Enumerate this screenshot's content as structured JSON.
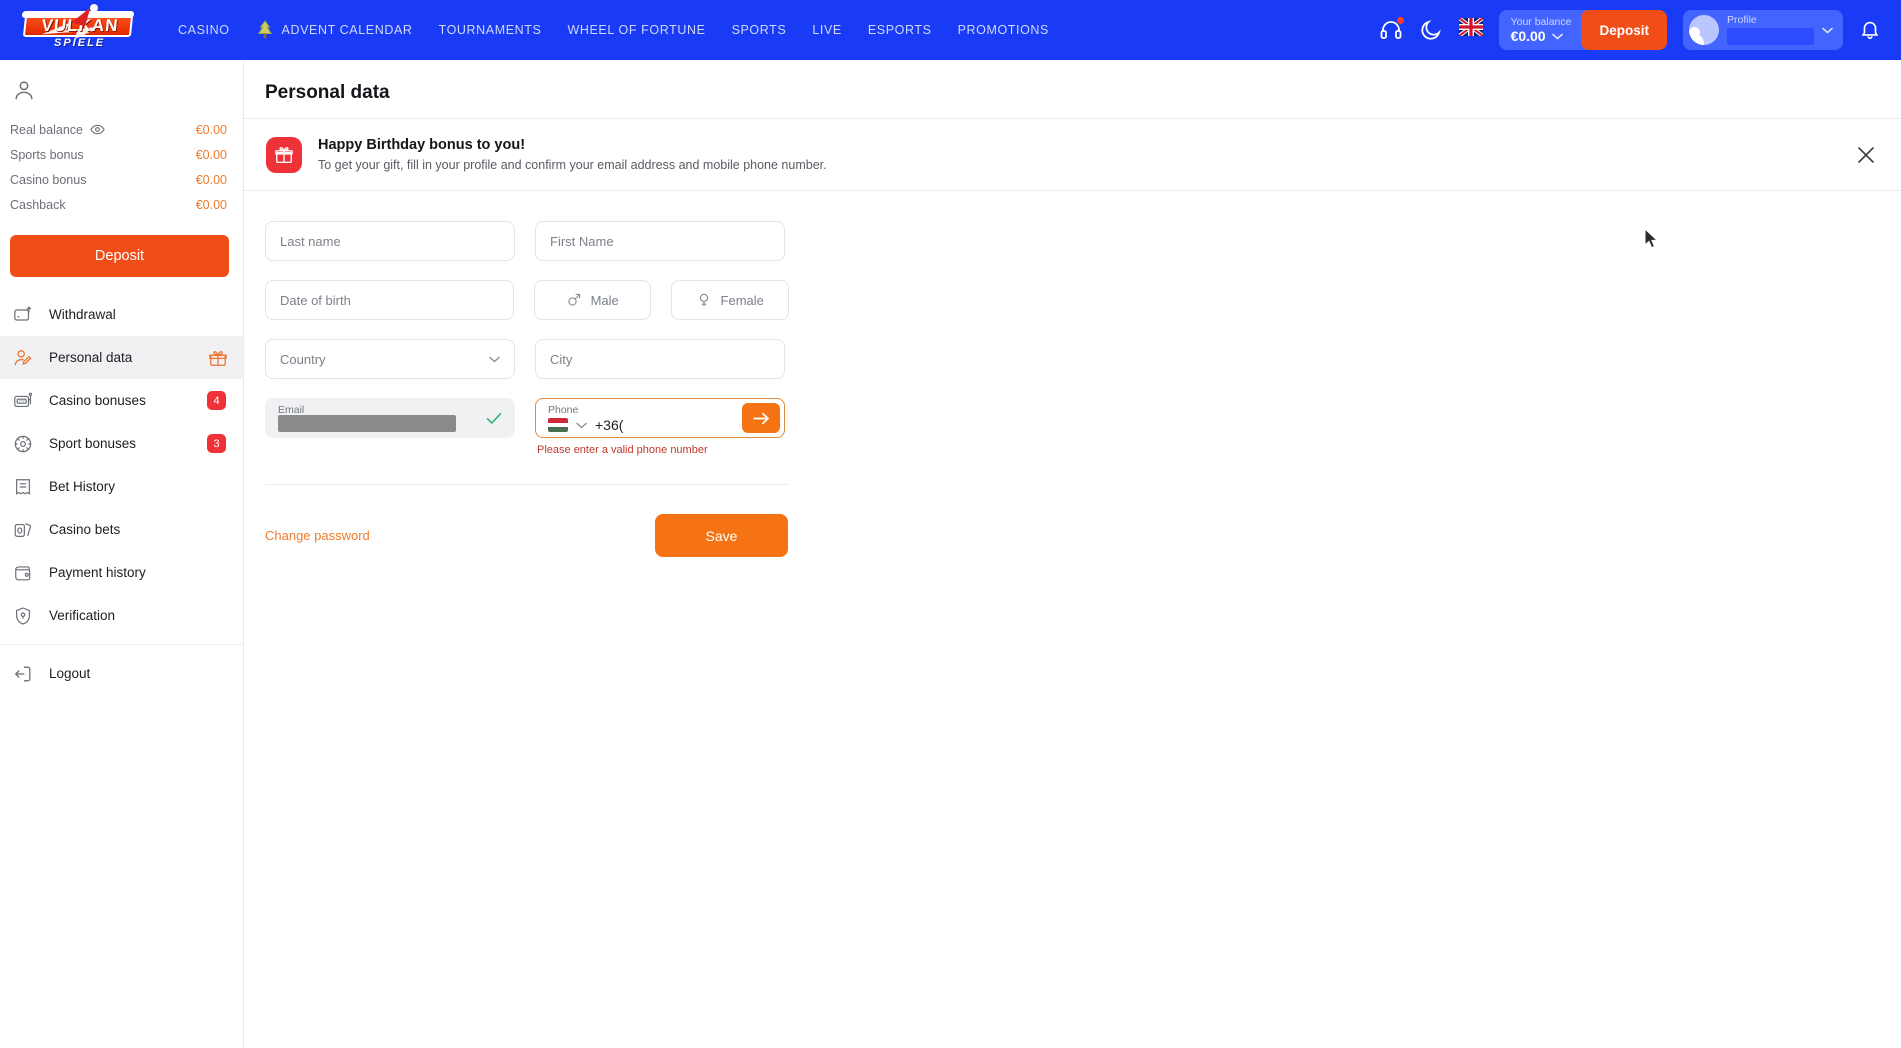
{
  "header": {
    "logo": {
      "word": "VULKAN",
      "sub": "SPIELE"
    },
    "nav": [
      {
        "label": "CASINO",
        "icon": ""
      },
      {
        "label": "ADVENT CALENDAR",
        "icon": "tree-icon"
      },
      {
        "label": "TOURNAMENTS",
        "icon": ""
      },
      {
        "label": "WHEEL OF FORTUNE",
        "icon": ""
      },
      {
        "label": "SPORTS",
        "icon": ""
      },
      {
        "label": "LIVE",
        "icon": ""
      },
      {
        "label": "ESPORTS",
        "icon": ""
      },
      {
        "label": "PROMOTIONS",
        "icon": ""
      }
    ],
    "support_icon": "headset-icon",
    "theme_icon": "moon-icon",
    "language_icon": "uk-flag-icon",
    "balance_label": "Your balance",
    "balance_amount": "€0.00",
    "deposit_label": "Deposit",
    "profile_label": "Profile",
    "bell_icon": "bell-icon",
    "accent": "#F04D18",
    "brand_blue": "#1A3BF5"
  },
  "sidebar": {
    "balances": [
      {
        "label": "Real balance",
        "value": "€0.00",
        "eye": true
      },
      {
        "label": "Sports bonus",
        "value": "€0.00",
        "eye": false
      },
      {
        "label": "Casino bonus",
        "value": "€0.00",
        "eye": false
      },
      {
        "label": "Cashback",
        "value": "€0.00",
        "eye": false
      }
    ],
    "deposit_label": "Deposit",
    "items": [
      {
        "label": "Withdrawal",
        "icon": "withdrawal-icon",
        "badge": "",
        "active": false,
        "gift": false
      },
      {
        "label": "Personal data",
        "icon": "personal-data-icon",
        "badge": "",
        "active": true,
        "gift": true
      },
      {
        "label": "Casino bonuses",
        "icon": "slot-machine-icon",
        "badge": "4",
        "active": false,
        "gift": false
      },
      {
        "label": "Sport bonuses",
        "icon": "football-icon",
        "badge": "3",
        "active": false,
        "gift": false
      },
      {
        "label": "Bet History",
        "icon": "receipt-icon",
        "badge": "",
        "active": false,
        "gift": false
      },
      {
        "label": "Casino bets",
        "icon": "cards-icon",
        "badge": "",
        "active": false,
        "gift": false
      },
      {
        "label": "Payment history",
        "icon": "wallet-icon",
        "badge": "",
        "active": false,
        "gift": false
      },
      {
        "label": "Verification",
        "icon": "shield-key-icon",
        "badge": "",
        "active": false,
        "gift": false
      }
    ],
    "logout": {
      "label": "Logout",
      "icon": "logout-icon"
    }
  },
  "main": {
    "page_title": "Personal data",
    "banner": {
      "icon": "gift-icon",
      "title": "Happy Birthday bonus to you!",
      "subtitle": "To get your gift, fill in your profile and confirm your email address and mobile phone number.",
      "close_icon": "close-icon",
      "icon_color": "#EE3237"
    },
    "form": {
      "last_name": {
        "placeholder": "Last name",
        "value": ""
      },
      "first_name": {
        "placeholder": "First Name",
        "value": ""
      },
      "date_of_birth": {
        "placeholder": "Date of birth",
        "value": ""
      },
      "gender_male": {
        "label": "Male",
        "icon": "male-symbol-icon"
      },
      "gender_female": {
        "label": "Female",
        "icon": "female-symbol-icon"
      },
      "country": {
        "placeholder": "Country",
        "value": "",
        "chevron": "chevron-down-icon"
      },
      "city": {
        "placeholder": "City",
        "value": ""
      },
      "email": {
        "label": "Email",
        "value": "",
        "masked": true,
        "verified_icon": "check-icon"
      },
      "phone": {
        "label": "Phone",
        "value": "+36(",
        "flag": "hungary-flag-icon",
        "submit_icon": "arrow-right-icon",
        "error": "Please enter a valid phone number",
        "error_color": "#C0392B",
        "border_color": "#E08A3C"
      },
      "change_password": "Change password",
      "save": "Save"
    }
  }
}
